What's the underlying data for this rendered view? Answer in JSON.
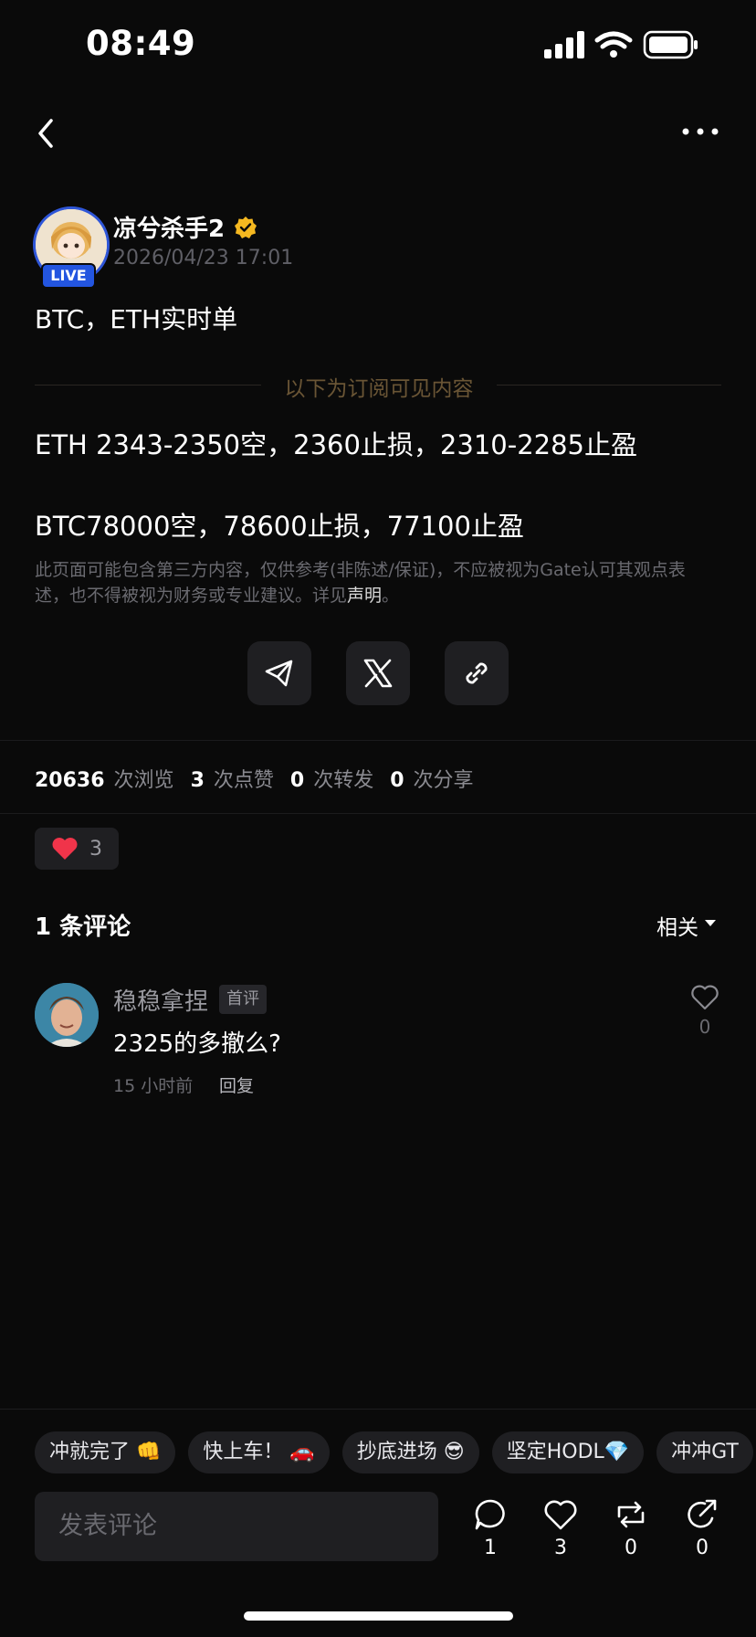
{
  "status_bar": {
    "time": "08:49"
  },
  "author": {
    "name": "凉兮杀手2",
    "live_label": "LIVE",
    "timestamp": "2026/04/23 17:01"
  },
  "post": {
    "title": "BTC，ETH实时单",
    "subscriber_divider": "以下为订阅可见内容",
    "lines": [
      "ETH 2343-2350空，2360止损，2310-2285止盈",
      "BTC78000空，78600止损，77100止盈"
    ],
    "disclaimer_prefix": "此页面可能包含第三方内容，仅供参考(非陈述/保证)，不应被视为Gate认可其观点表述，也不得被视为财务或专业建议。详见",
    "disclaimer_link": "声明",
    "disclaimer_suffix": "。"
  },
  "stats": {
    "views": "20636",
    "views_label": "次浏览",
    "likes": "3",
    "likes_label": "次点赞",
    "reposts": "0",
    "reposts_label": "次转发",
    "shares": "0",
    "shares_label": "次分享"
  },
  "reaction": {
    "count": "3"
  },
  "comments": {
    "title": "1 条评论",
    "sort_label": "相关",
    "items": [
      {
        "name": "稳稳拿捏",
        "badge": "首评",
        "text": "2325的多撤么?",
        "time": "15 小时前",
        "reply_label": "回复",
        "likes": "0"
      }
    ]
  },
  "quick_replies": [
    "冲就完了 👊",
    "快上车！ 🚗",
    "抄底进场 😎",
    "坚定HODL💎",
    "冲冲GT"
  ],
  "bottom_bar": {
    "input_placeholder": "发表评论",
    "comment_count": "1",
    "like_count": "3",
    "repost_count": "0",
    "share_count": "0"
  },
  "colors": {
    "background": "#0a0a0a",
    "accent_live": "#2355e0",
    "verified": "#f5b820",
    "heart": "#f0344a",
    "divider_text": "#6a5535"
  }
}
